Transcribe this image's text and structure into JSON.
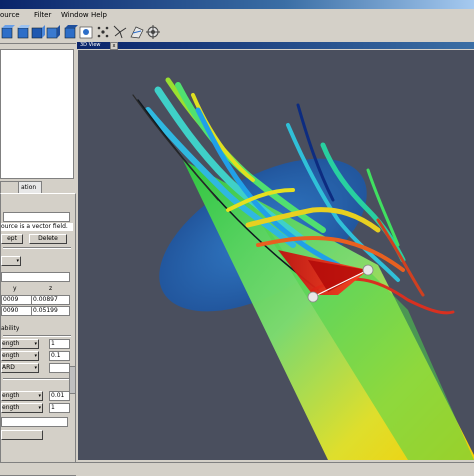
{
  "menu": {
    "items": [
      "Source",
      "Filter",
      "Window",
      "Help"
    ],
    "partial_first": "ource"
  },
  "left_panel": {
    "tab_label": "ation",
    "status_text": "ource is a vector field.",
    "delete_label": "Delete",
    "accept_label": "ept",
    "dropdown1": "",
    "col_y": "y",
    "col_z": "z",
    "row1": {
      "y": "0009",
      "z": "0.00897"
    },
    "row2": {
      "y": "0090",
      "z": "0.05199"
    },
    "section_label": "ability",
    "len_rows": [
      {
        "label": "ength",
        "value": "1"
      },
      {
        "label": "ength",
        "value": "0.1"
      },
      {
        "label": "ARD",
        "value": ""
      }
    ],
    "len_rows2": [
      {
        "label": "ength",
        "value": "0.01"
      },
      {
        "label": "ength",
        "value": "1"
      }
    ]
  },
  "view": {
    "title": "3D View",
    "close_glyph": "x"
  },
  "colors": {
    "viewport_bg": "#4a4f5e",
    "disc": "#1e5aa8",
    "cone_tip": "#ffd400",
    "cone_mid": "#2ecc40",
    "cone_base": "#e81010"
  }
}
